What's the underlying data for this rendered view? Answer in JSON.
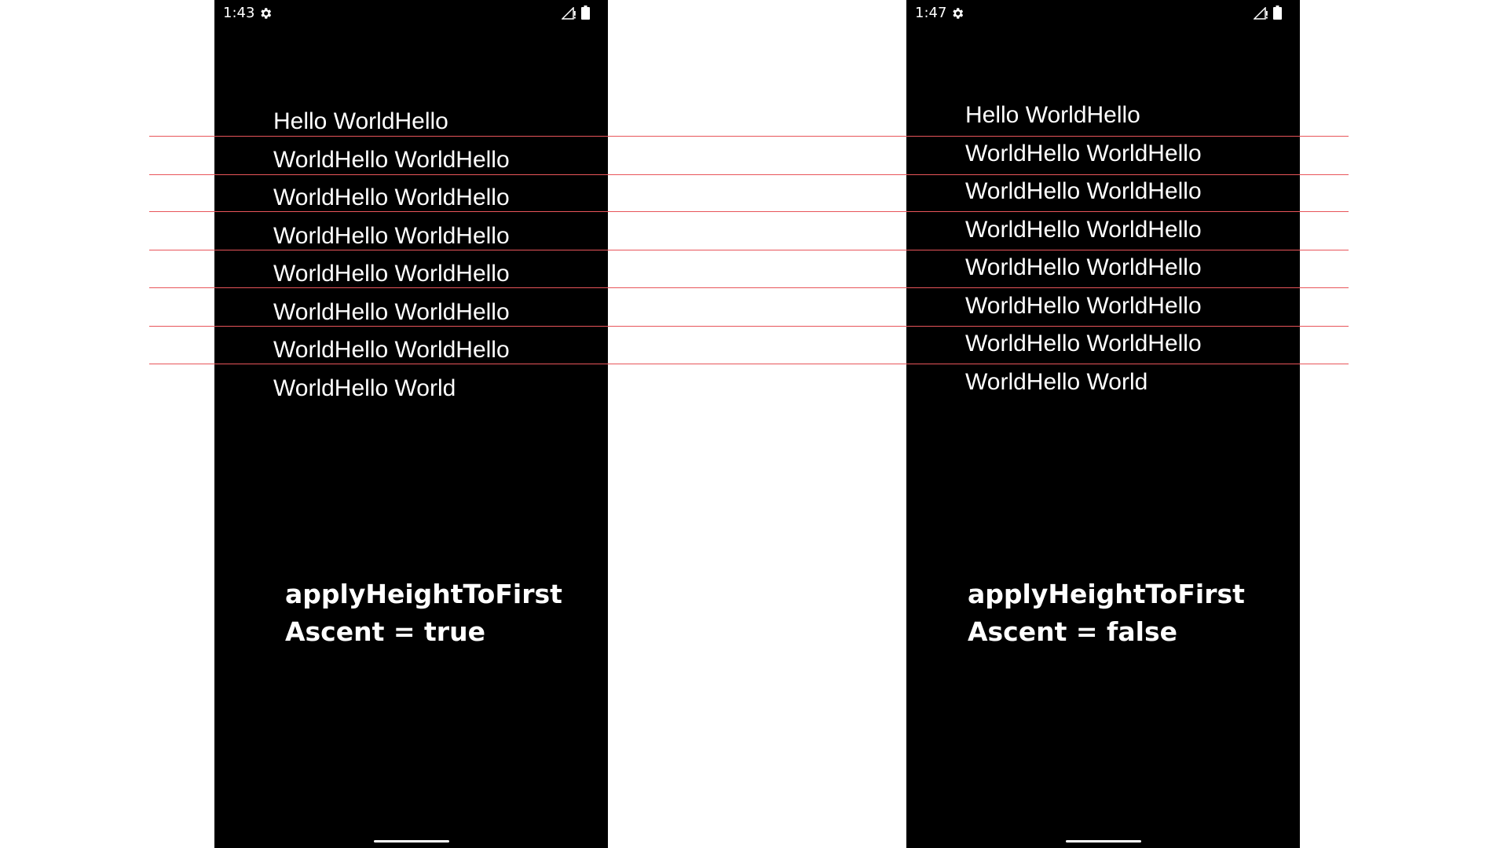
{
  "colors": {
    "page_background": "#ffffff",
    "phone_background": "#000000",
    "text": "#ffffff",
    "guide_line": "#e8555a"
  },
  "phones": [
    {
      "status": {
        "time": "1:43",
        "settings_icon": "gear-icon",
        "signal_icon": "signal-icon",
        "battery_icon": "battery-icon"
      },
      "text_lines": [
        "Hello WorldHello",
        "WorldHello WorldHello",
        "WorldHello WorldHello",
        "WorldHello WorldHello",
        "WorldHello WorldHello",
        "WorldHello WorldHello",
        "WorldHello WorldHello",
        "WorldHello World"
      ],
      "caption": [
        "applyHeightToFirst",
        "Ascent = true"
      ]
    },
    {
      "status": {
        "time": "1:47",
        "settings_icon": "gear-icon",
        "signal_icon": "signal-icon",
        "battery_icon": "battery-icon"
      },
      "text_lines": [
        "Hello WorldHello",
        "WorldHello WorldHello",
        "WorldHello WorldHello",
        "WorldHello WorldHello",
        "WorldHello WorldHello",
        "WorldHello WorldHello",
        "WorldHello WorldHello",
        "WorldHello World"
      ],
      "caption": [
        "applyHeightToFirst",
        "Ascent = false"
      ]
    }
  ]
}
